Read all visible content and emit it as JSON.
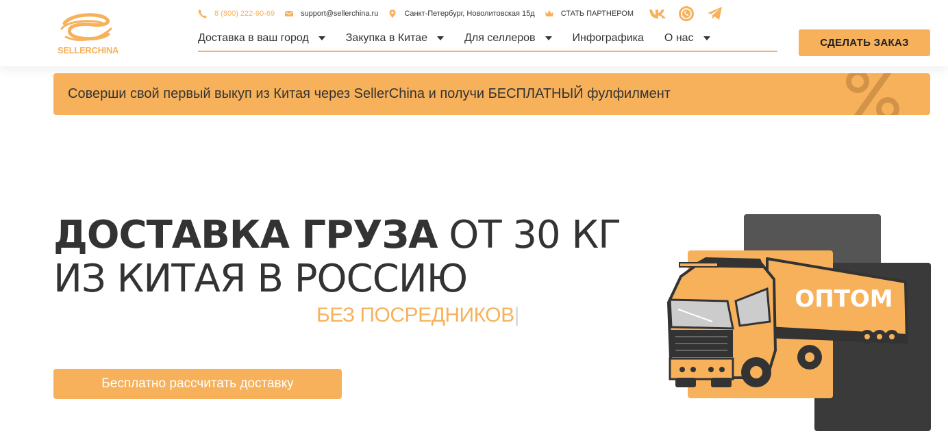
{
  "brand": {
    "name": "SELLERCHINA",
    "accent": "#f7b15b",
    "dark": "#333333"
  },
  "topbar": {
    "phone": "8 (800) 222-90-69",
    "email": "support@sellerchina.ru",
    "address": "Санкт-Петербург, Новолитовская 15д",
    "partner": "СТАТЬ ПАРТНЕРОМ",
    "social": [
      "vk-icon",
      "whatsapp-icon",
      "telegram-icon"
    ]
  },
  "nav": {
    "items": [
      {
        "label": "Доставка в ваш город",
        "dropdown": true
      },
      {
        "label": "Закупка в Китае",
        "dropdown": true
      },
      {
        "label": "Для селлеров",
        "dropdown": true
      },
      {
        "label": "Инфографика",
        "dropdown": false
      },
      {
        "label": "О нас",
        "dropdown": true
      }
    ]
  },
  "order_button": "СДЕЛАТЬ ЗАКАЗ",
  "promo": {
    "text": "Соверши свой первый выкуп из Китая через SellerChina и получи БЕСПЛАТНЫЙ фулфилмент"
  },
  "hero": {
    "title_bold": "ДОСТАВКА ГРУЗА",
    "title_rest": " ОТ 30 КГ",
    "title_line2": "ИЗ КИТАЯ В РОССИЮ",
    "subtitle": "БЕЗ ПОСРЕДНИКОВ",
    "cursor": "|",
    "cta": "Бесплатно рассчитать доставку",
    "truck_label": "ОПТОМ"
  }
}
